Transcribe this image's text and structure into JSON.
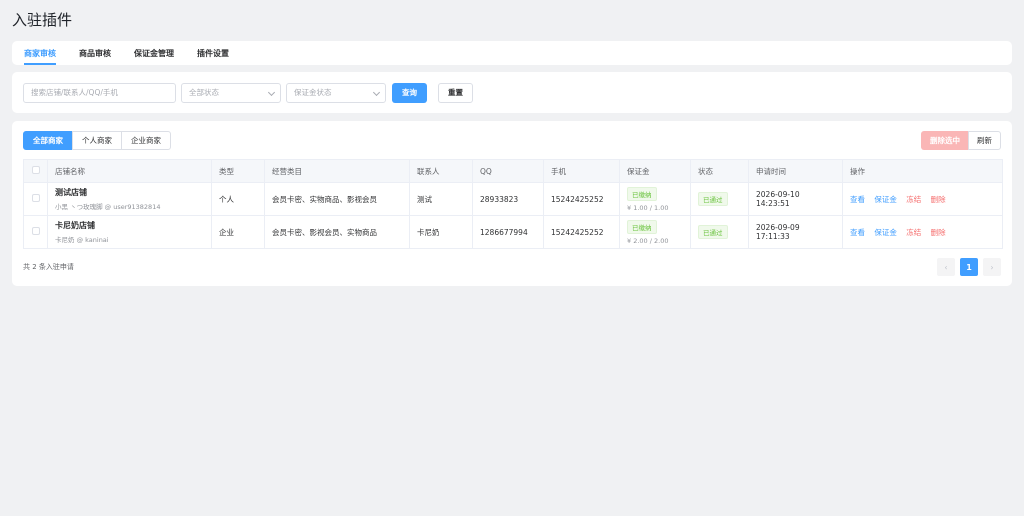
{
  "page": {
    "title": "入驻插件"
  },
  "tabs": [
    {
      "label": "商家审核",
      "active": true
    },
    {
      "label": "商品审核",
      "active": false
    },
    {
      "label": "保证金管理",
      "active": false
    },
    {
      "label": "插件设置",
      "active": false
    }
  ],
  "filter": {
    "search_placeholder": "搜索店铺/联系人/QQ/手机",
    "status_placeholder": "全部状态",
    "deposit_placeholder": "保证金状态",
    "query_label": "查询",
    "reset_label": "重置"
  },
  "toolbar": {
    "segments": [
      {
        "label": "全部商家",
        "active": true
      },
      {
        "label": "个人商家",
        "active": false
      },
      {
        "label": "企业商家",
        "active": false
      }
    ],
    "delete_selected_label": "删除选中",
    "refresh_label": "刷新"
  },
  "table": {
    "columns": [
      "店铺名称",
      "类型",
      "经营类目",
      "联系人",
      "QQ",
      "手机",
      "保证金",
      "状态",
      "申请时间",
      "操作"
    ],
    "rows": [
      {
        "store_name": "测试店铺",
        "store_sub": "小黑 丶つ玫瑰脚 @ user91382814",
        "type": "个人",
        "category": "会员卡密、实物商品、影视会员",
        "contact": "测试",
        "qq": "28933823",
        "phone": "15242425252",
        "deposit_tag": "已缴纳",
        "deposit_amount": "¥ 1.00 / 1.00",
        "status": "已通过",
        "applied_at": "2026-09-10 14:23:51",
        "ops": [
          "查看",
          "保证金",
          "冻结",
          "删除"
        ]
      },
      {
        "store_name": "卡尼奶店铺",
        "store_sub": "卡尼奶 @ kaninai",
        "type": "企业",
        "category": "会员卡密、影视会员、实物商品",
        "contact": "卡尼奶",
        "qq": "1286677994",
        "phone": "15242425252",
        "deposit_tag": "已缴纳",
        "deposit_amount": "¥ 2.00 / 2.00",
        "status": "已通过",
        "applied_at": "2026-09-09 17:11:33",
        "ops": [
          "查看",
          "保证金",
          "冻结",
          "删除"
        ]
      }
    ]
  },
  "footer": {
    "total_text": "共 2 条入驻申请",
    "prev": "‹",
    "current_page": "1",
    "next": "›"
  },
  "colors": {
    "accent": "#409eff",
    "danger": "#f56c6c",
    "success": "#67c23a"
  }
}
